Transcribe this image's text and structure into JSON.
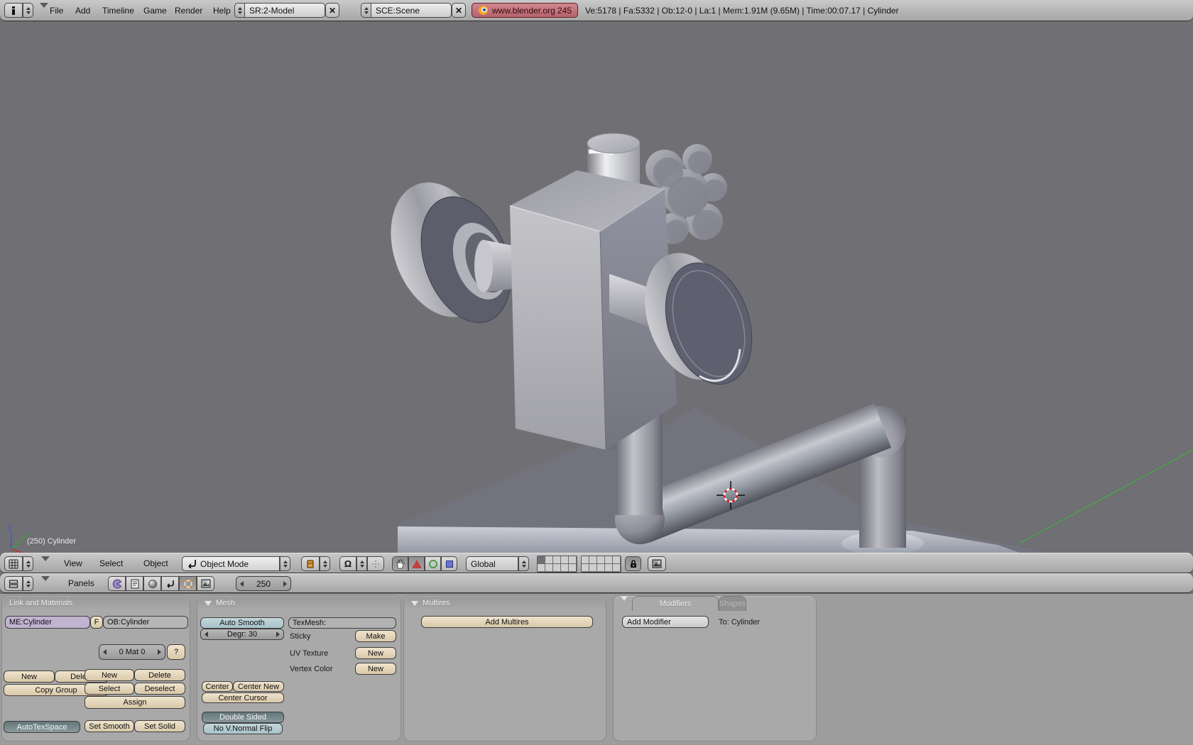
{
  "topbar": {
    "menus": [
      "File",
      "Add",
      "Timeline",
      "Game",
      "Render",
      "Help"
    ],
    "screen_selector": "SR:2-Model",
    "scene_selector": "SCE:Scene",
    "version_button": "www.blender.org 245",
    "stats": "Ve:5178 | Fa:5332 | Ob:12-0 | La:1 | Mem:1.91M (9.65M) | Time:00:07.17 | Cylinder"
  },
  "viewport": {
    "object_label": "(250) Cylinder",
    "axis_z": "Z"
  },
  "view3d": {
    "menus": [
      "View",
      "Select",
      "Object"
    ],
    "mode": "Object Mode",
    "orientation": "Global"
  },
  "buttons_header": {
    "panels_label": "Panels",
    "frame_value": "250"
  },
  "panels": {
    "link": {
      "title": "Link and Materials",
      "me": "ME:Cylinder",
      "f": "F",
      "ob": "OB:Cylinder",
      "mat": "0 Mat 0",
      "help": "?",
      "new1": "New",
      "delete1": "Delete",
      "copy_group": "Copy Group",
      "new2": "New",
      "delete2": "Delete",
      "select": "Select",
      "deselect": "Deselect",
      "assign": "Assign",
      "autotexspace": "AutoTexSpace",
      "set_smooth": "Set Smooth",
      "set_solid": "Set Solid"
    },
    "mesh": {
      "title": "Mesh",
      "auto_smooth": "Auto Smooth",
      "degr": "Degr: 30",
      "texmesh": "TexMesh:",
      "sticky": "Sticky",
      "make": "Make",
      "uv_texture": "UV Texture",
      "uv_new": "New",
      "vertex_color": "Vertex Color",
      "vc_new": "New",
      "center": "Center",
      "center_new": "Center New",
      "center_cursor": "Center Cursor",
      "double_sided": "Double Sided",
      "no_vnormal_flip": "No V.Normal Flip"
    },
    "multires": {
      "title": "Multires",
      "add": "Add Multires"
    },
    "modifiers": {
      "tab_modifiers": "Modifiers",
      "tab_shapes": "Shapes",
      "add_modifier": "Add Modifier",
      "target": "To: Cylinder"
    }
  },
  "colors": {
    "header_bg": "#b4b4b4",
    "viewport_bg": "#6f6f74",
    "panel_bg": "#a9a9a9",
    "beige_button": "#e3d5bd",
    "toggle_dark": "#7c9093",
    "toggle_blue": "#b7ced4",
    "field_purple": "#c0b4d1",
    "version_button_bg": "#c4747e",
    "axis_green": "#4aa54a",
    "manip_red": "#c24040",
    "manip_green": "#4a9a4a",
    "manip_blue": "#6a74c8"
  }
}
